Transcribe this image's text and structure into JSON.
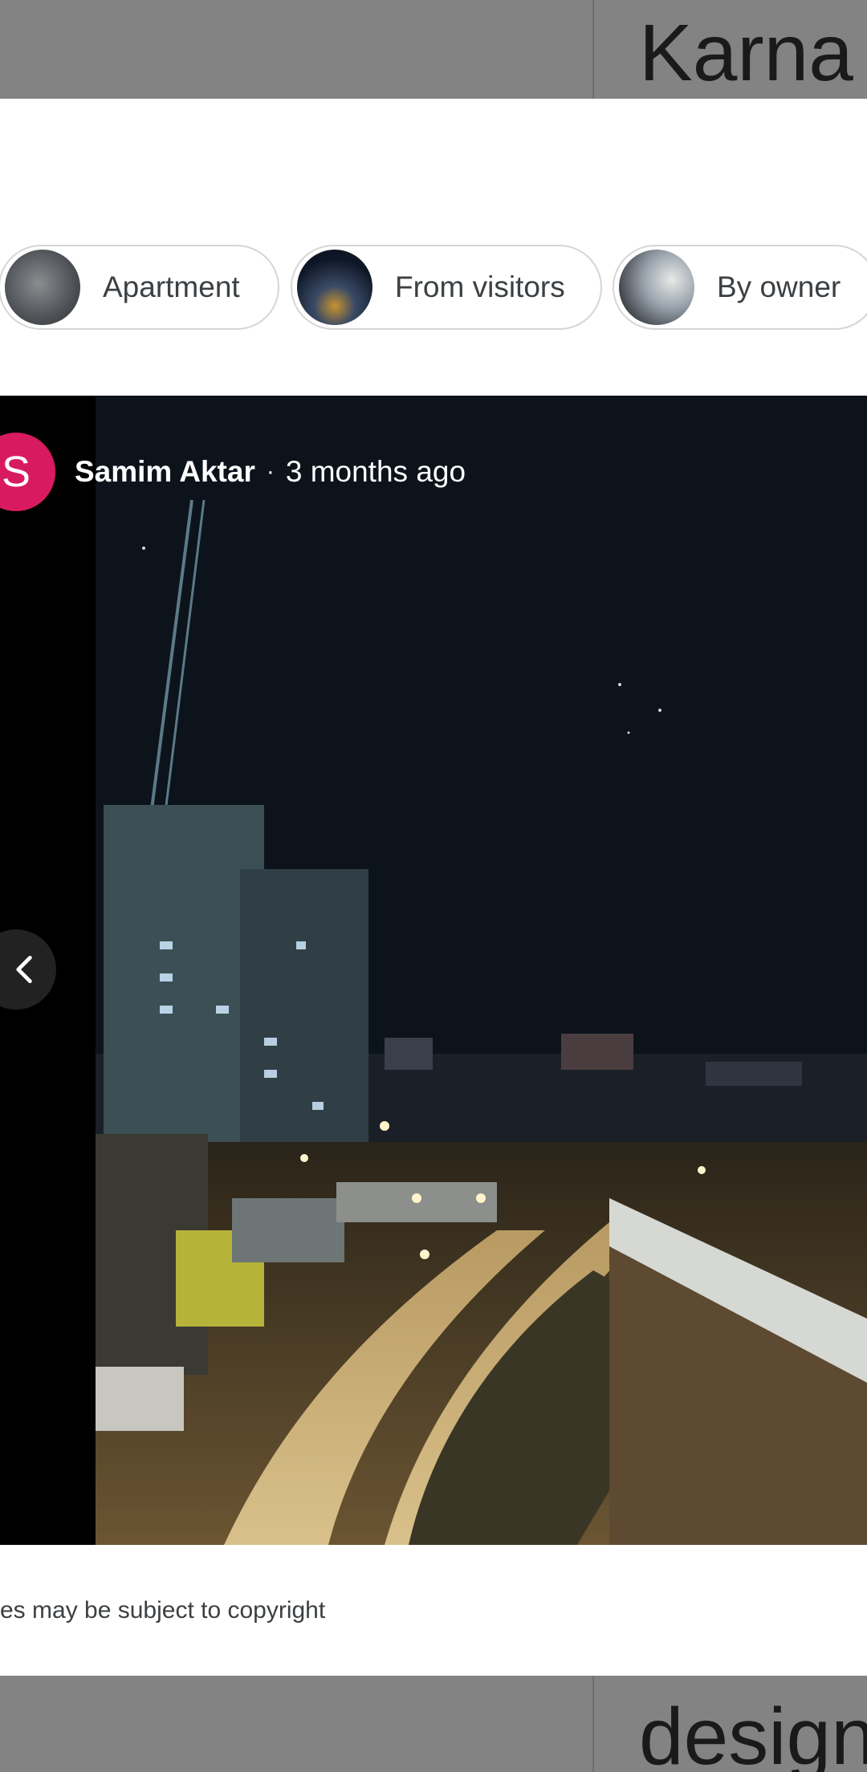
{
  "top_band": {
    "partial_word": "Karna"
  },
  "chips": [
    {
      "label": "Apartment"
    },
    {
      "label": "From visitors"
    },
    {
      "label": "By owner"
    }
  ],
  "viewer": {
    "author_initial": "S",
    "author_name": "Samim Aktar",
    "separator": "·",
    "posted": "3 months ago",
    "avatar_color": "#d81b60"
  },
  "copyright_notice": "es may be subject to copyright",
  "bottom_band": {
    "partial_word": "design"
  }
}
